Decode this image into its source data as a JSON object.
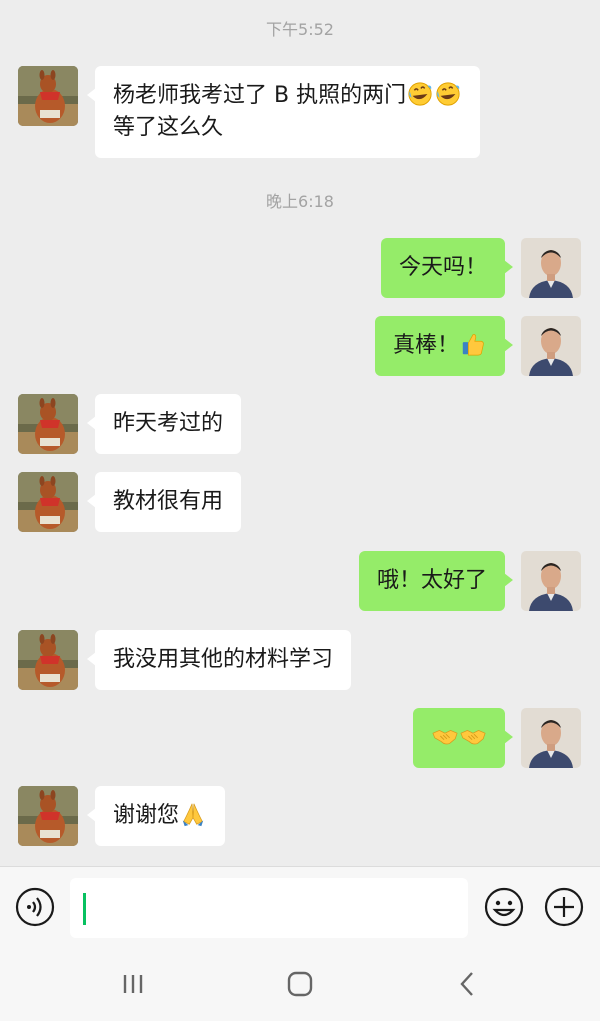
{
  "chat": {
    "timestamps": [
      "下午5:52",
      "晚上6:18"
    ],
    "messages": [
      {
        "sender": "contact",
        "avatar": "kangaroo-avatar",
        "lines": [
          "杨老师我考过了 B 执照的两门",
          "等了这么久"
        ],
        "emoji": [
          "rolling-on-floor-laughing-emoji",
          "rolling-on-floor-laughing-emoji"
        ]
      },
      {
        "sender": "me",
        "avatar": "teacher-avatar",
        "text": "今天吗！"
      },
      {
        "sender": "me",
        "avatar": "teacher-avatar",
        "text": "真棒！",
        "emoji": [
          "thumbs-up-emoji"
        ]
      },
      {
        "sender": "contact",
        "avatar": "kangaroo-avatar",
        "text": "昨天考过的"
      },
      {
        "sender": "contact",
        "avatar": "kangaroo-avatar",
        "text": "教材很有用"
      },
      {
        "sender": "me",
        "avatar": "teacher-avatar",
        "text": "哦！太好了"
      },
      {
        "sender": "contact",
        "avatar": "kangaroo-avatar",
        "text": "我没用其他的材料学习"
      },
      {
        "sender": "me",
        "avatar": "teacher-avatar",
        "text": "",
        "emoji": [
          "handshake-emoji",
          "handshake-emoji"
        ]
      },
      {
        "sender": "contact",
        "avatar": "kangaroo-avatar",
        "text": "谢谢您",
        "emoji": [
          "folded-hands-emoji"
        ]
      }
    ]
  },
  "input_bar": {
    "voice_icon": "voice-icon",
    "input_value": "",
    "emoji_icon": "smiley-icon",
    "plus_icon": "plus-icon"
  },
  "nav_bar": {
    "icons": [
      "recent-apps-icon",
      "home-icon",
      "back-icon"
    ]
  },
  "colors": {
    "background": "#ededed",
    "incoming_bubble": "#ffffff",
    "outgoing_bubble": "#95ec69",
    "timestamp": "#a3a3a3",
    "caret": "#07c160"
  }
}
